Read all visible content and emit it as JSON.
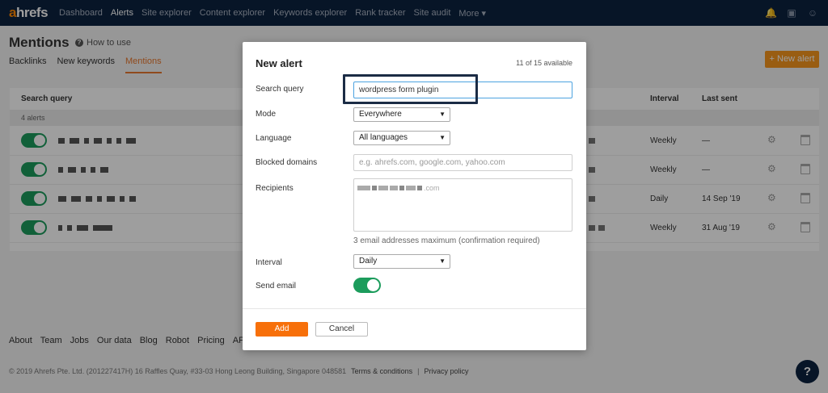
{
  "app": {
    "logo_a": "a",
    "logo_rest": "hrefs"
  },
  "nav": {
    "items": [
      {
        "label": "Dashboard",
        "active": false
      },
      {
        "label": "Alerts",
        "active": true
      },
      {
        "label": "Site explorer",
        "active": false
      },
      {
        "label": "Content explorer",
        "active": false
      },
      {
        "label": "Keywords explorer",
        "active": false
      },
      {
        "label": "Rank tracker",
        "active": false
      },
      {
        "label": "Site audit",
        "active": false
      },
      {
        "label": "More ▾",
        "active": false
      }
    ],
    "icons": [
      "bell-icon",
      "inbox-icon",
      "user-icon"
    ]
  },
  "page": {
    "title": "Mentions",
    "how_to": "How to use",
    "tabs": [
      {
        "label": "Backlinks",
        "active": false
      },
      {
        "label": "New keywords",
        "active": false
      },
      {
        "label": "Mentions",
        "active": true
      }
    ],
    "new_alert_button": "+ New alert"
  },
  "table": {
    "headers": {
      "search_query": "Search query",
      "interval": "Interval",
      "last_sent": "Last sent"
    },
    "count": "4 alerts",
    "rows": [
      {
        "interval": "Weekly",
        "last_sent": "—"
      },
      {
        "interval": "Weekly",
        "last_sent": "—"
      },
      {
        "interval": "Daily",
        "last_sent": "14 Sep '19"
      },
      {
        "interval": "Weekly",
        "last_sent": "31 Aug '19"
      }
    ]
  },
  "footer": {
    "links": [
      "About",
      "Team",
      "Jobs",
      "Our data",
      "Blog",
      "Robot",
      "Pricing",
      "API"
    ],
    "copyright": "© 2019 Ahrefs Pte. Ltd. (201227417H) 16 Raffles Quay, #33-03 Hong Leong Building, Singapore 048581",
    "terms": "Terms & conditions",
    "sep": "|",
    "privacy": "Privacy policy",
    "help": "?"
  },
  "modal": {
    "title": "New alert",
    "available": "11 of 15 available",
    "search_query": {
      "label": "Search query",
      "value": "wordpress form plugin"
    },
    "mode": {
      "label": "Mode",
      "value": "Everywhere"
    },
    "language": {
      "label": "Language",
      "value": "All languages"
    },
    "blocked_domains": {
      "label": "Blocked domains",
      "placeholder": "e.g. ahrefs.com, google.com, yahoo.com"
    },
    "recipients": {
      "label": "Recipients",
      "hint": "3 email addresses maximum (confirmation required)",
      "visible_suffix": ".com"
    },
    "interval": {
      "label": "Interval",
      "value": "Daily"
    },
    "send_email": {
      "label": "Send email",
      "on": true
    },
    "add_button": "Add",
    "cancel_button": "Cancel"
  }
}
